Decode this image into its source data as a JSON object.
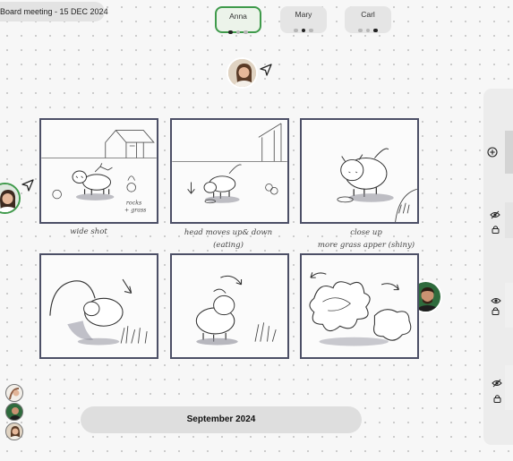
{
  "header": {
    "session_title": "Board meeting - 15 DEC 2024"
  },
  "users": [
    {
      "name": "Anna",
      "active": true,
      "dots": [
        true,
        false,
        false
      ]
    },
    {
      "name": "Mary",
      "active": false,
      "dots": [
        false,
        true,
        false
      ]
    },
    {
      "name": "Carl",
      "active": false,
      "dots": [
        false,
        false,
        true
      ]
    }
  ],
  "storyboard": {
    "captions": {
      "frame_1": "wide shot",
      "frame_2_line_1": "head moves up& down",
      "frame_2_line_2": "(eating)",
      "frame_3_line_1": "close up",
      "frame_3_line_2": "more grass apper (shiny)",
      "frame_1_note_1": "rocks",
      "frame_1_note_2": "+ grass"
    }
  },
  "right_sidebar": {
    "icons": [
      "add-icon",
      "eye-off-icon",
      "lock-icon",
      "eye-icon",
      "lock-icon",
      "eye-off-icon",
      "lock-icon"
    ]
  },
  "footer": {
    "month_label": "September 2024"
  },
  "colors": {
    "accent_green": "#3f9a4b",
    "frame_border": "#4c4f66"
  }
}
